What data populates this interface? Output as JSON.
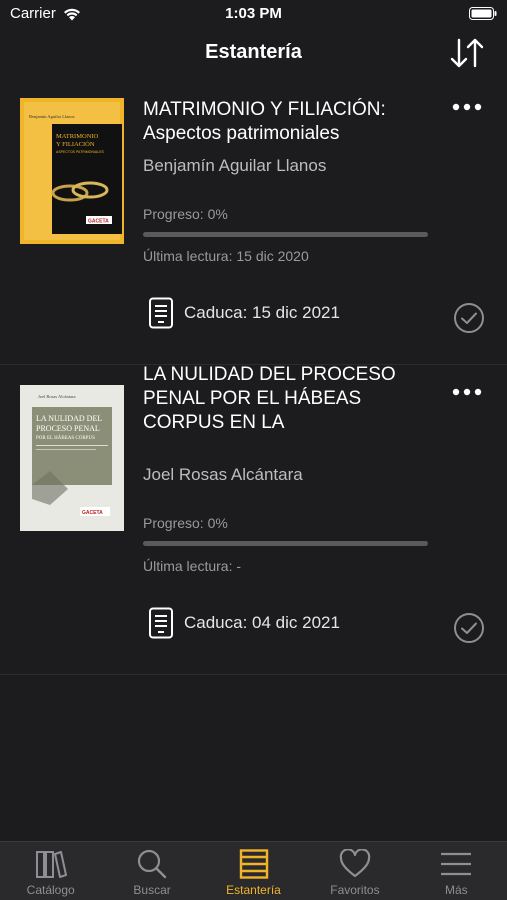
{
  "status_bar": {
    "carrier": "Carrier",
    "time": "1:03 PM"
  },
  "nav": {
    "title": "Estantería",
    "sort_icon": "sort-arrows-icon"
  },
  "books": [
    {
      "title": "MATRIMONIO Y FILIACIÓN: Aspectos patrimoniales",
      "author": "Benjamín Aguilar Llanos",
      "progress_label": "Progreso: 0%",
      "progress_fraction": 0,
      "last_read": "Última lectura: 15 dic 2020",
      "expiry": "Caduca: 15 dic 2021",
      "cover": {
        "color": "#f0b429",
        "author": "Benjamín Aguilar Llanos",
        "title_line1": "MATRIMONIO",
        "title_line2": "Y FILIACIÓN",
        "subtitle": "ASPECTOS PATRIMONIALES",
        "publisher": "GACETA"
      }
    },
    {
      "title": "LA NULIDAD DEL PROCESO PENAL POR EL HÁBEAS CORPUS EN LA",
      "author": "Joel Rosas Alcántara",
      "progress_label": "Progreso: 0%",
      "progress_fraction": 0,
      "last_read": "Última lectura: -",
      "expiry": "Caduca: 04 dic 2021",
      "cover": {
        "color": "#e9e9e4",
        "author": "Joel Rosas Alcántara",
        "title_line1": "LA NULIDAD DEL",
        "title_line2": "PROCESO PENAL",
        "subtitle": "POR EL HÁBEAS CORPUS",
        "publisher": "GACETA"
      }
    }
  ],
  "tabs": [
    {
      "label": "Catálogo",
      "icon": "books-icon"
    },
    {
      "label": "Buscar",
      "icon": "search-icon"
    },
    {
      "label": "Estantería",
      "icon": "shelf-icon",
      "active": true
    },
    {
      "label": "Favoritos",
      "icon": "heart-icon"
    },
    {
      "label": "Más",
      "icon": "menu-icon"
    }
  ],
  "colors": {
    "accent": "#f0b429",
    "background": "#1c1c1e",
    "tab_bar": "#2a2a2c"
  }
}
